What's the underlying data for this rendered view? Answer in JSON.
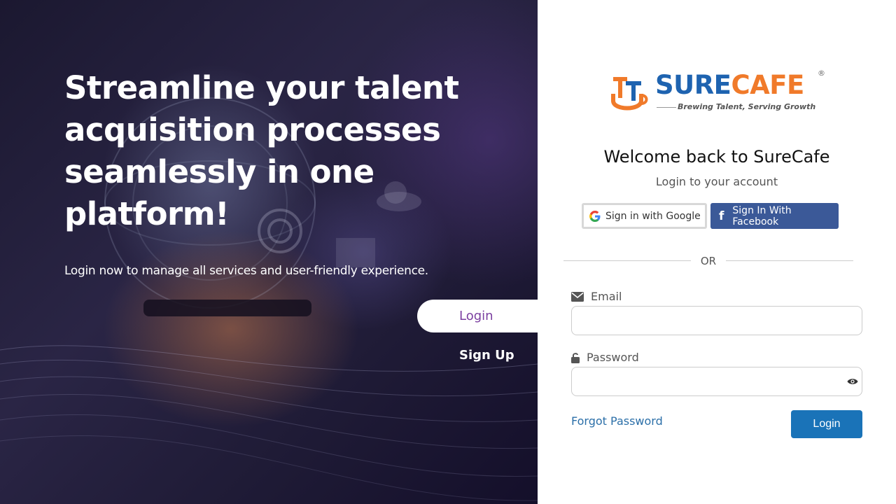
{
  "hero": {
    "title": "Streamline your talent acquisition processes seamlessly in one platform!",
    "subtitle": "Login now to manage all services and user-friendly experience.",
    "tabs": {
      "login": "Login",
      "signup": "Sign Up"
    }
  },
  "brand": {
    "name_part1": "SURE",
    "name_part2": "CAFE",
    "registered": "®",
    "tagline": "Brewing Talent, Serving Growth",
    "colors": {
      "blue": "#1e63b0",
      "orange": "#f07a2a"
    }
  },
  "login": {
    "welcome": "Welcome back to SureCafe",
    "subtitle": "Login to your account",
    "google_label": "Sign in with Google",
    "facebook_label": "Sign In With Facebook",
    "or_label": "OR",
    "email_label": "Email",
    "email_value": "",
    "password_label": "Password",
    "password_value": "",
    "forgot_label": "Forgot Password",
    "submit_label": "Login",
    "colors": {
      "primary": "#1a73b8",
      "facebook": "#3b5998",
      "link": "#2b6fa8",
      "tab_text": "#7b3fa0"
    }
  }
}
